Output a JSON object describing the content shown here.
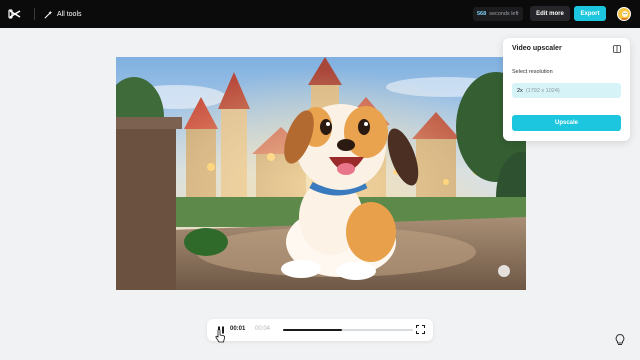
{
  "header": {
    "all_tools_label": "All tools",
    "credits_value": "568",
    "credits_suffix": "seconds left",
    "edit_more_label": "Edit more",
    "export_label": "Export"
  },
  "panel": {
    "title": "Video upscaler",
    "select_label": "Select resolution",
    "resolution_scale": "2x",
    "resolution_dims": "(1792 x 1024)",
    "upscale_label": "Upscale"
  },
  "player": {
    "current_time": "00:01",
    "total_time": "00:04",
    "progress": 0.45
  },
  "colors": {
    "accent": "#1cc6de",
    "topbar": "#0b0b0c",
    "background": "#f0f2f3"
  },
  "icons": [
    "capcut-logo-icon",
    "magic-wand-icon",
    "avatar",
    "panel-toggle-icon",
    "pause-icon",
    "fullscreen-icon",
    "cursor-icon",
    "lightbulb-icon"
  ]
}
